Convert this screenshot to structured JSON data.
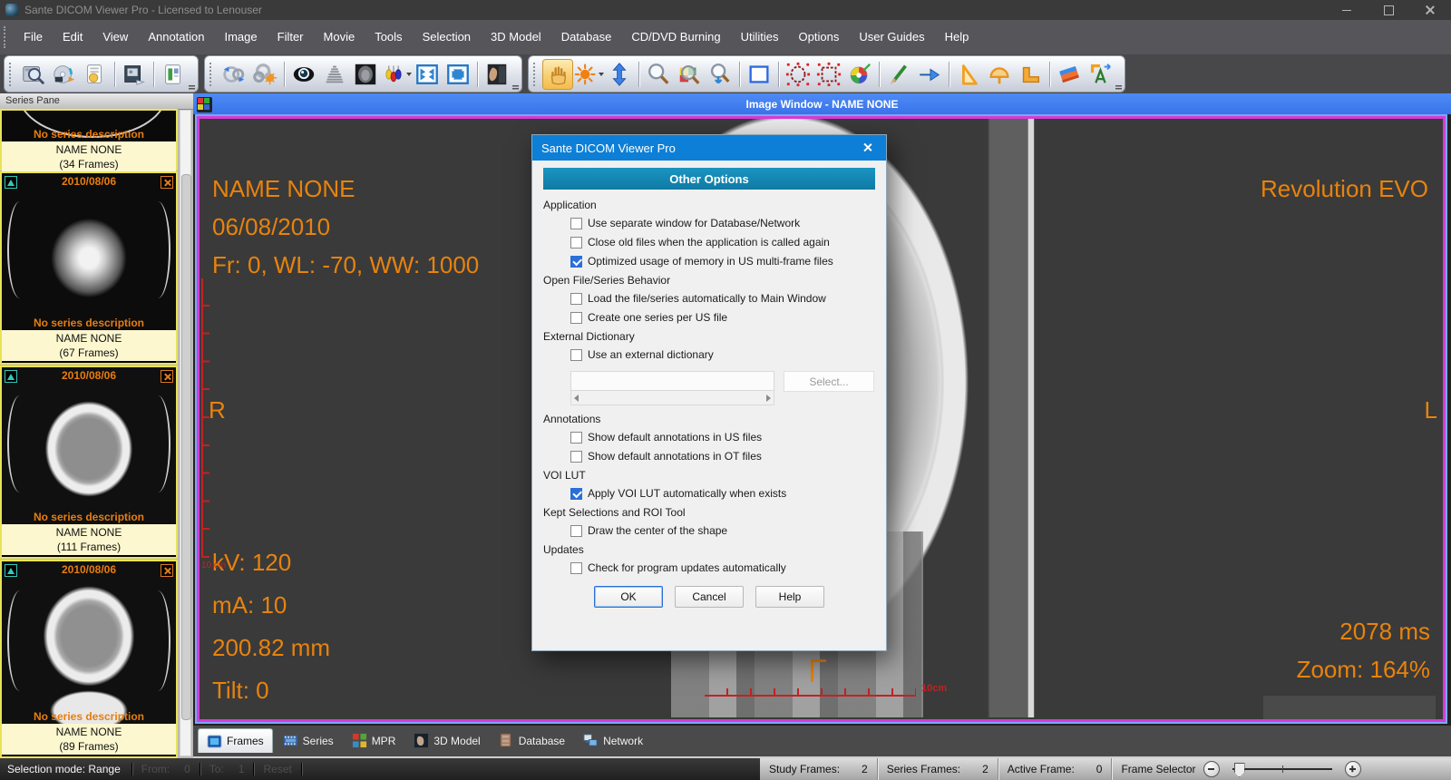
{
  "window": {
    "title": "Sante DICOM Viewer Pro - Licensed to Lenouser"
  },
  "menubar": {
    "items": [
      "File",
      "Edit",
      "View",
      "Annotation",
      "Image",
      "Filter",
      "Movie",
      "Tools",
      "Selection",
      "3D Model",
      "Database",
      "CD/DVD Burning",
      "Utilities",
      "Options",
      "User Guides",
      "Help"
    ]
  },
  "toolbar": {
    "groups": [
      {
        "icons": [
          "open-database",
          "burn-cd",
          "report",
          "print-image",
          "new-report"
        ]
      },
      {
        "icons": [
          "sync-link",
          "auto-link",
          "shutter-eye",
          "histogram",
          "mpr-head",
          "hanging-protocol",
          "fit-to-window",
          "fullscreen",
          "photo-gallery"
        ]
      },
      {
        "icons": [
          "pan-hand",
          "brightness-contrast",
          "window-level",
          "zoom",
          "zoom-selection",
          "zoom-pan",
          "rectangle-select",
          "ellipse-roi",
          "rectangle-roi",
          "color-palette",
          "pencil",
          "arrow-annotation",
          "set-square",
          "protractor",
          "angle-ruler",
          "eraser",
          "text-annotation"
        ],
        "active_icon": "pan-hand"
      }
    ]
  },
  "series_pane": {
    "title": "Series Pane",
    "thumbnails": [
      {
        "date": "",
        "description": "No series description",
        "name": "NAME NONE",
        "frames": "(34 Frames)"
      },
      {
        "date": "2010/08/06",
        "description": "No series description",
        "name": "NAME NONE",
        "frames": "(67 Frames)"
      },
      {
        "date": "2010/08/06",
        "description": "No series description",
        "name": "NAME NONE",
        "frames": "(111 Frames)"
      },
      {
        "date": "2010/08/06",
        "description": "No series description",
        "name": "NAME NONE",
        "frames": "(89 Frames)"
      }
    ]
  },
  "image_window": {
    "title": "Image Window - NAME NONE",
    "overlay": {
      "patient": "NAME NONE",
      "date": "06/08/2010",
      "frame_info": "Fr: 0, WL: -70, WW: 1000",
      "station": "Revolution EVO",
      "marker_right_side": "R",
      "marker_left_side": "L",
      "kv": "kV: 120",
      "ma": "mA: 10",
      "distance": "200.82 mm",
      "tilt": "Tilt: 0",
      "exposure": "2078 ms",
      "zoom": "Zoom: 164%",
      "vruler_label": "10\ncm",
      "hruler_label": "10cm"
    }
  },
  "dialog": {
    "title": "Sante DICOM Viewer Pro",
    "header": "Other Options",
    "sections": [
      {
        "label": "Application",
        "items": [
          {
            "label": "Use separate window for Database/Network",
            "checked": false
          },
          {
            "label": "Close old files when the application is called again",
            "checked": false
          },
          {
            "label": "Optimized usage of memory in US multi-frame files",
            "checked": true
          }
        ]
      },
      {
        "label": "Open File/Series Behavior",
        "items": [
          {
            "label": "Load the file/series automatically to Main Window",
            "checked": false
          },
          {
            "label": "Create one series per US file",
            "checked": false
          }
        ]
      },
      {
        "label": "External Dictionary",
        "items": [
          {
            "label": "Use an external dictionary",
            "checked": false
          }
        ]
      },
      {
        "label": "Annotations",
        "items": [
          {
            "label": "Show default annotations in US files",
            "checked": false
          },
          {
            "label": "Show default annotations in OT files",
            "checked": false
          }
        ]
      },
      {
        "label": "VOI LUT",
        "items": [
          {
            "label": "Apply VOI LUT automatically when exists",
            "checked": true
          }
        ]
      },
      {
        "label": "Kept Selections and ROI Tool",
        "items": [
          {
            "label": "Draw the center of the shape",
            "checked": false
          }
        ]
      },
      {
        "label": "Updates",
        "items": [
          {
            "label": "Check for program updates automatically",
            "checked": false
          }
        ]
      }
    ],
    "dictionary_field": {
      "value": "",
      "select_button": "Select..."
    },
    "buttons": {
      "ok": "OK",
      "cancel": "Cancel",
      "help": "Help"
    }
  },
  "tabbar": {
    "tabs": [
      {
        "label": "Frames",
        "active": true
      },
      {
        "label": "Series",
        "active": false
      },
      {
        "label": "MPR",
        "active": false
      },
      {
        "label": "3D Model",
        "active": false
      },
      {
        "label": "Database",
        "active": false
      },
      {
        "label": "Network",
        "active": false
      }
    ]
  },
  "statusbar": {
    "selection_mode": "Selection mode: Range",
    "from_label": "From:",
    "from_value": "0",
    "to_label": "To:",
    "to_value": "1",
    "reset": "Reset",
    "study_frames_label": "Study Frames:",
    "study_frames_value": "2",
    "series_frames_label": "Series Frames:",
    "series_frames_value": "2",
    "active_frame_label": "Active Frame:",
    "active_frame_value": "0",
    "frame_selector_label": "Frame Selector"
  },
  "colors": {
    "overlay_orange": "#e8830c",
    "ruler_red": "#c32222",
    "viewport_bg": "#3a3a3a",
    "magenta_border": "#d63bd6",
    "dialog_titlebar_blue": "#0d7fd6",
    "dialog_header_teal": "#1585ae",
    "thumb_border_yellow": "#e9e257",
    "caption_cream": "#fcf7cf"
  }
}
